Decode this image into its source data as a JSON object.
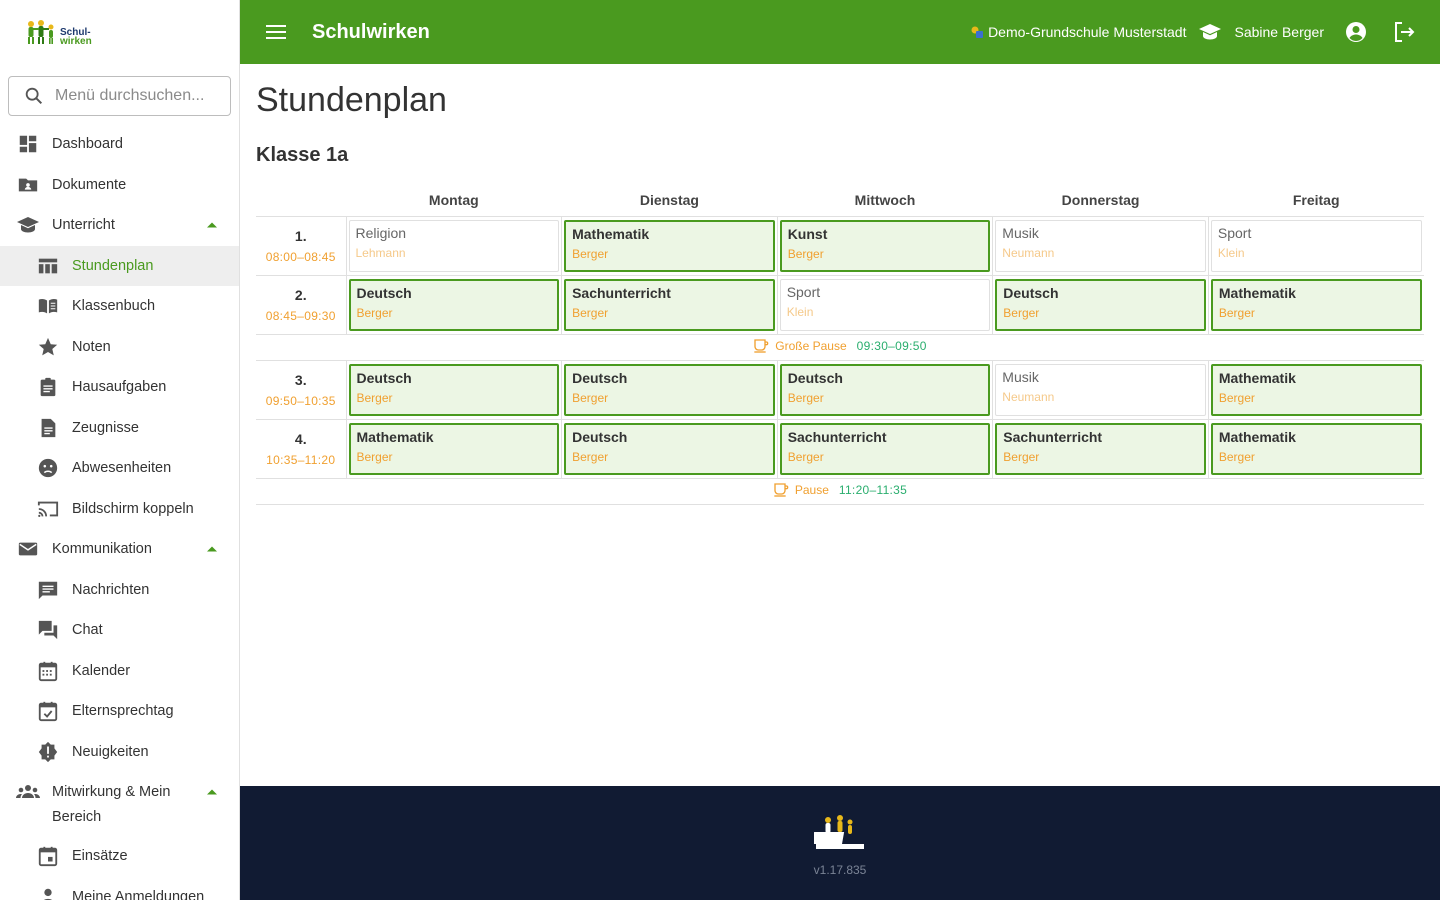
{
  "app": {
    "title": "Schulwirken",
    "school": "Demo-Grundschule Musterstadt",
    "user": "Sabine Berger"
  },
  "logo": {
    "line1": "Schul-",
    "line2": "wirken"
  },
  "search": {
    "placeholder": "Menü durchsuchen..."
  },
  "sidebar": {
    "items": [
      {
        "label": "Dashboard",
        "icon": "dashboard-icon",
        "level": 0
      },
      {
        "label": "Dokumente",
        "icon": "folder-icon",
        "level": 0
      },
      {
        "label": "Unterricht",
        "icon": "school-icon",
        "level": 0,
        "expanded": true
      },
      {
        "label": "Stundenplan",
        "icon": "timetable-icon",
        "level": 1,
        "active": true
      },
      {
        "label": "Klassenbuch",
        "icon": "book-icon",
        "level": 1
      },
      {
        "label": "Noten",
        "icon": "star-icon",
        "level": 1
      },
      {
        "label": "Hausaufgaben",
        "icon": "assignment-icon",
        "level": 1
      },
      {
        "label": "Zeugnisse",
        "icon": "document-icon",
        "level": 1
      },
      {
        "label": "Abwesenheiten",
        "icon": "sick-face-icon",
        "level": 1
      },
      {
        "label": "Bildschirm koppeln",
        "icon": "cast-icon",
        "level": 1
      },
      {
        "label": "Kommunikation",
        "icon": "mail-icon",
        "level": 0,
        "expanded": true
      },
      {
        "label": "Nachrichten",
        "icon": "message-icon",
        "level": 1
      },
      {
        "label": "Chat",
        "icon": "chat-icon",
        "level": 1
      },
      {
        "label": "Kalender",
        "icon": "calendar-icon",
        "level": 1
      },
      {
        "label": "Elternsprechtag",
        "icon": "event-check-icon",
        "level": 1
      },
      {
        "label": "Neuigkeiten",
        "icon": "news-badge-icon",
        "level": 1
      },
      {
        "label": "Mitwirkung & Mein Bereich",
        "icon": "people-icon",
        "level": 0,
        "expanded": true
      },
      {
        "label": "Einsätze",
        "icon": "event-icon",
        "level": 1
      },
      {
        "label": "Meine Anmeldungen",
        "icon": "person-icon",
        "level": 1
      }
    ]
  },
  "main": {
    "title": "Stundenplan",
    "class_name": "Klasse 1a",
    "days": [
      "Montag",
      "Dienstag",
      "Mittwoch",
      "Donnerstag",
      "Freitag"
    ],
    "periods": [
      {
        "num": "1.",
        "time": "08:00–08:45",
        "lessons": [
          {
            "subject": "Religion",
            "teacher": "Lehmann",
            "mine": false
          },
          {
            "subject": "Mathematik",
            "teacher": "Berger",
            "mine": true
          },
          {
            "subject": "Kunst",
            "teacher": "Berger",
            "mine": true
          },
          {
            "subject": "Musik",
            "teacher": "Neumann",
            "mine": false
          },
          {
            "subject": "Sport",
            "teacher": "Klein",
            "mine": false
          }
        ]
      },
      {
        "num": "2.",
        "time": "08:45–09:30",
        "lessons": [
          {
            "subject": "Deutsch",
            "teacher": "Berger",
            "mine": true
          },
          {
            "subject": "Sachunterricht",
            "teacher": "Berger",
            "mine": true
          },
          {
            "subject": "Sport",
            "teacher": "Klein",
            "mine": false
          },
          {
            "subject": "Deutsch",
            "teacher": "Berger",
            "mine": true
          },
          {
            "subject": "Mathematik",
            "teacher": "Berger",
            "mine": true
          }
        ]
      },
      {
        "break": true,
        "label": "Große Pause",
        "time": "09:30–09:50"
      },
      {
        "num": "3.",
        "time": "09:50–10:35",
        "lessons": [
          {
            "subject": "Deutsch",
            "teacher": "Berger",
            "mine": true
          },
          {
            "subject": "Deutsch",
            "teacher": "Berger",
            "mine": true
          },
          {
            "subject": "Deutsch",
            "teacher": "Berger",
            "mine": true
          },
          {
            "subject": "Musik",
            "teacher": "Neumann",
            "mine": false
          },
          {
            "subject": "Mathematik",
            "teacher": "Berger",
            "mine": true
          }
        ]
      },
      {
        "num": "4.",
        "time": "10:35–11:20",
        "lessons": [
          {
            "subject": "Mathematik",
            "teacher": "Berger",
            "mine": true
          },
          {
            "subject": "Deutsch",
            "teacher": "Berger",
            "mine": true
          },
          {
            "subject": "Sachunterricht",
            "teacher": "Berger",
            "mine": true
          },
          {
            "subject": "Sachunterricht",
            "teacher": "Berger",
            "mine": true
          },
          {
            "subject": "Mathematik",
            "teacher": "Berger",
            "mine": true
          }
        ]
      },
      {
        "break": true,
        "label": "Pause",
        "time": "11:20–11:35"
      }
    ]
  },
  "footer": {
    "version": "v1.17.835"
  },
  "colors": {
    "brand": "#4a9a1f",
    "accent_orange": "#f0a030",
    "break_time": "#2aae6e",
    "footer_bg": "#111b33",
    "lesson_bg": "#ecf6e4"
  }
}
